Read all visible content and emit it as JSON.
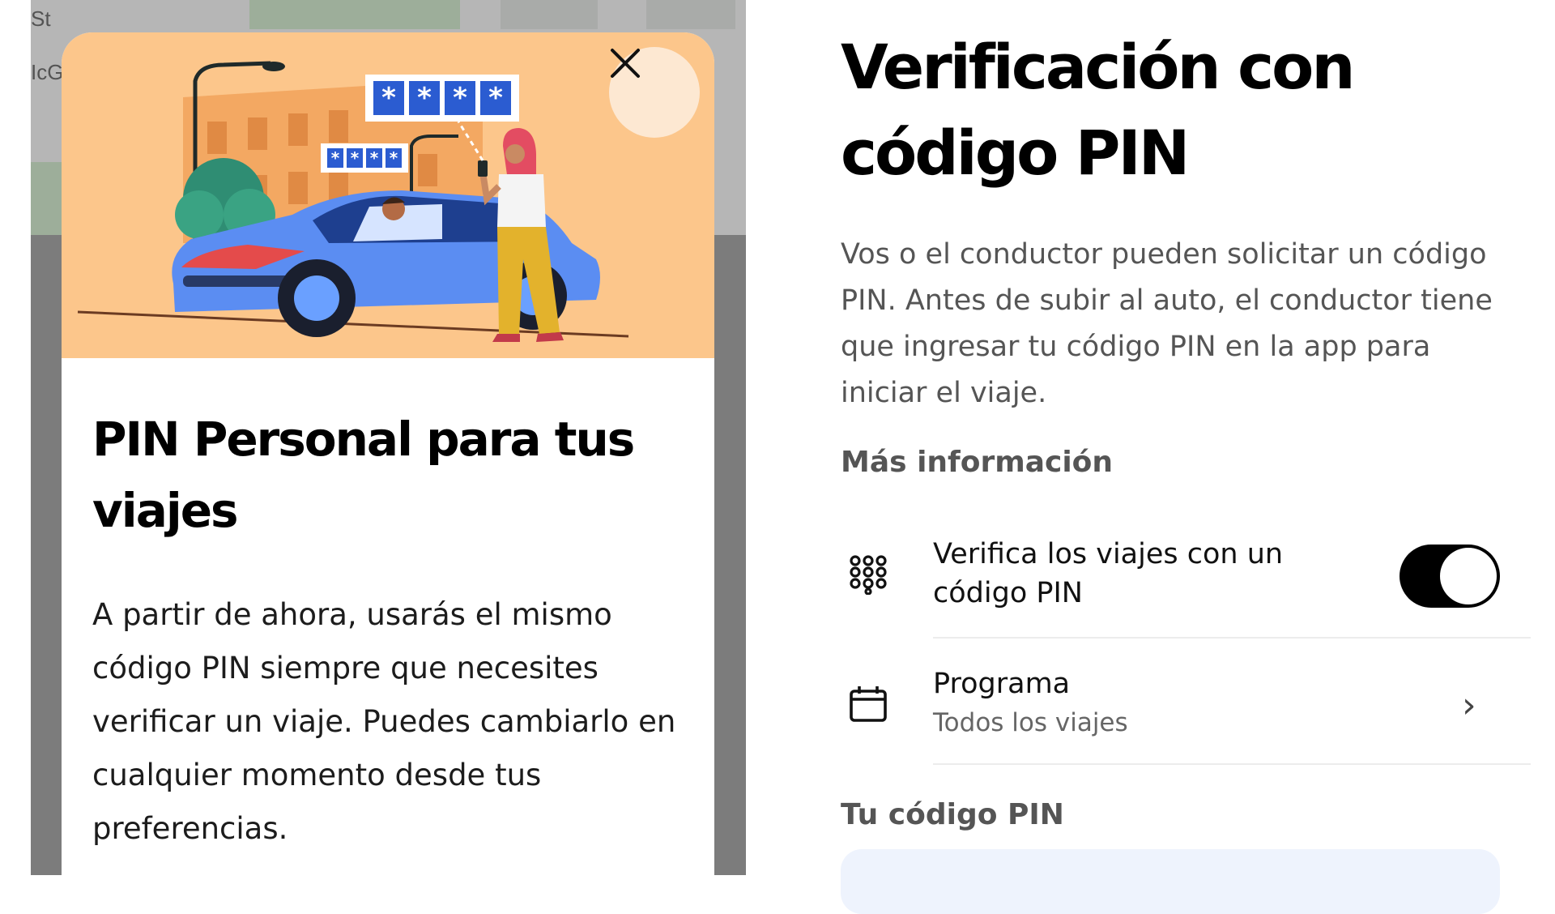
{
  "left_screen": {
    "map_labels": [
      "St",
      "IcG"
    ],
    "hero": {
      "pin_sign_large": [
        "*",
        "*",
        "*",
        "*"
      ],
      "pin_sign_small": [
        "*",
        "*",
        "*",
        "*"
      ]
    },
    "title": "PIN Personal para tus viajes",
    "description": "A partir de ahora, usarás el mismo código PIN siempre que necesites verificar un viaje. Puedes cambiarlo en cualquier momento desde tus preferencias."
  },
  "right_screen": {
    "title": "Verificación con código PIN",
    "description": "Vos o el conductor pueden solicitar un código PIN. Antes de subir al auto, el conductor tiene que ingresar tu código PIN en la app para iniciar el viaje.",
    "more_info": "Más información",
    "verify_row": {
      "label": "Verifica los viajes con un código PIN",
      "enabled": true
    },
    "schedule_row": {
      "label": "Programa",
      "value": "Todos los viajes"
    },
    "pin_section_label": "Tu código PIN"
  },
  "icons": {
    "close": "close-icon",
    "keypad": "keypad-icon",
    "calendar": "calendar-icon",
    "chevron": "chevron-right-icon"
  },
  "colors": {
    "hero_background": "#fcc68b",
    "pin_blue": "#2b5cd1",
    "car_blue": "#5b8df2",
    "toggle_on": "#000000"
  }
}
